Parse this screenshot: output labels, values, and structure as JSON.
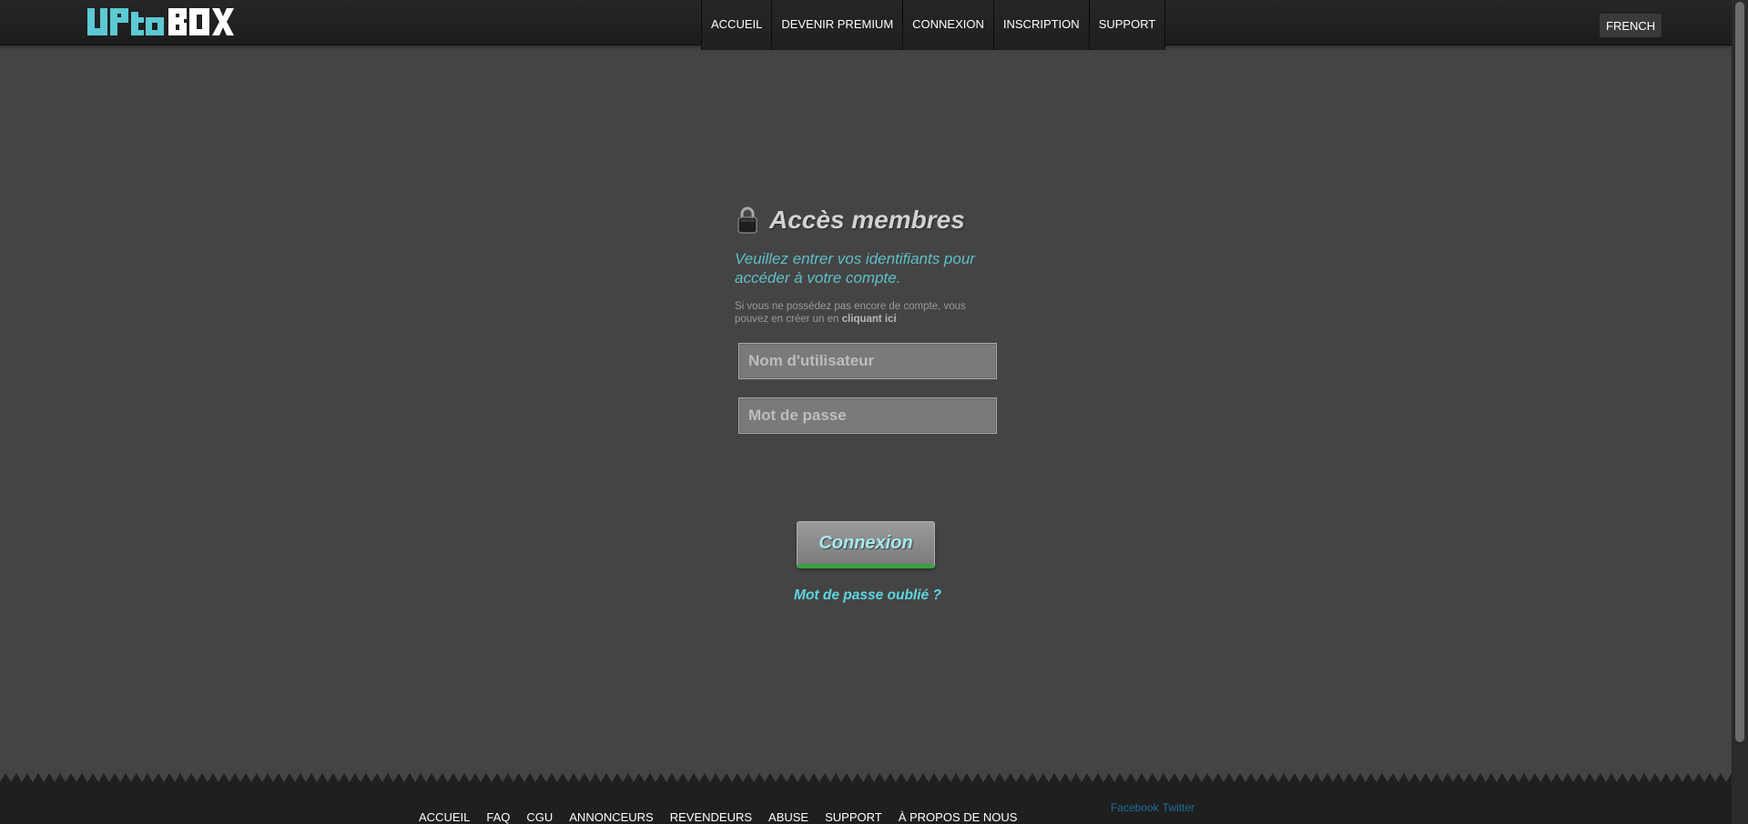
{
  "header": {
    "logo_text": "UPTOBOX",
    "nav": [
      {
        "label": "ACCUEIL"
      },
      {
        "label": "DEVENIR PREMIUM"
      },
      {
        "label": "CONNEXION"
      },
      {
        "label": "INSCRIPTION"
      },
      {
        "label": "SUPPORT"
      }
    ],
    "language": "FRENCH"
  },
  "login": {
    "title": "Accès membres",
    "subtitle": "Veuillez entrer vos identifiants pour accéder à votre compte.",
    "note_prefix": "Si vous ne possédez pas encore de compte, vous pouvez en créer un en",
    "note_link": "cliquant ici",
    "username_placeholder": "Nom d'utilisateur",
    "password_placeholder": "Mot de passe",
    "submit_label": "Connexion",
    "forgot_label": "Mot de passe oublié ?"
  },
  "footer": {
    "links": [
      {
        "label": "ACCUEIL"
      },
      {
        "label": "FAQ"
      },
      {
        "label": "CGU"
      },
      {
        "label": "ANNONCEURS"
      },
      {
        "label": "REVENDEURS"
      },
      {
        "label": "ABUSE"
      },
      {
        "label": "SUPPORT"
      },
      {
        "label": "À PROPOS DE NOUS"
      }
    ],
    "social": [
      {
        "label": "Facebook"
      },
      {
        "label": "Twitter"
      }
    ]
  },
  "colors": {
    "page_bg": "#444444",
    "header_bg": "#232323",
    "accent_cyan": "#5fbfc6",
    "button_underline_green": "#3aa043",
    "logo_cyan": "#5cc9d3"
  },
  "icons": {
    "lock": "lock-icon"
  }
}
